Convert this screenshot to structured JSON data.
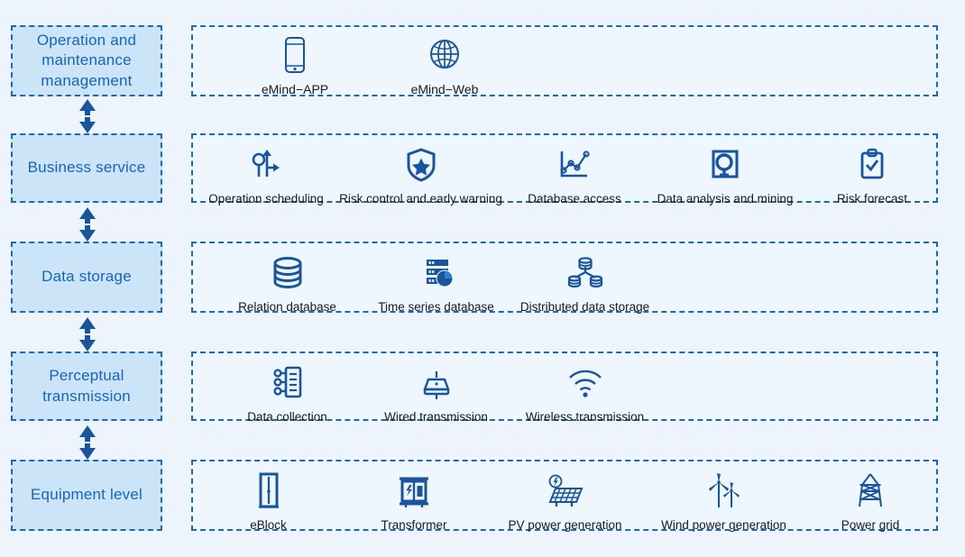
{
  "diagram": {
    "title": "Layered system architecture",
    "colors": {
      "background": "#eef4fc",
      "level_box_fill": "#cce4f7",
      "panel_fill": "#eef6fe",
      "border": "#1a6ab8",
      "level_text": "#1565c0",
      "icon": "#19559e",
      "caption_text": "#1b1b1b"
    },
    "levels": [
      {
        "id": "operation-and-maintenance-management",
        "label": "Operation and maintenance management",
        "items": [
          {
            "label": "eMind−APP",
            "icon": "smartphone-icon"
          },
          {
            "label": "eMind−Web",
            "icon": "globe-icon"
          }
        ]
      },
      {
        "id": "business-service",
        "label": "Business service",
        "items": [
          {
            "label": "Operation scheduling",
            "icon": "routing-arrows-icon"
          },
          {
            "label": "Risk control and early warning",
            "icon": "shield-star-icon"
          },
          {
            "label": "Database access",
            "icon": "line-chart-icon"
          },
          {
            "label": "Data analysis and mining",
            "icon": "magnifier-analysis-icon"
          },
          {
            "label": "Risk forecast",
            "icon": "clipboard-check-icon"
          }
        ]
      },
      {
        "id": "data-storage",
        "label": "Data storage",
        "items": [
          {
            "label": "Relation database",
            "icon": "database-cylinder-icon"
          },
          {
            "label": "Time series database",
            "icon": "server-pie-icon"
          },
          {
            "label": "Distributed data storage",
            "icon": "distributed-database-icon"
          }
        ]
      },
      {
        "id": "perceptual-transmission",
        "label": "Perceptual transmission",
        "items": [
          {
            "label": "Data collection",
            "icon": "data-collection-icon"
          },
          {
            "label": "Wired transmission",
            "icon": "wired-router-icon"
          },
          {
            "label": "Wireless transmission",
            "icon": "wifi-icon"
          }
        ]
      },
      {
        "id": "equipment-level",
        "label": "Equipment level",
        "items": [
          {
            "label": "eBlock",
            "icon": "cabinet-icon"
          },
          {
            "label": "Transformer",
            "icon": "transformer-icon"
          },
          {
            "label": "PV power generation",
            "icon": "solar-panel-icon"
          },
          {
            "label": "Wind power generation",
            "icon": "wind-turbine-icon"
          },
          {
            "label": "Power grid",
            "icon": "pylon-icon"
          }
        ]
      }
    ],
    "connectors": [
      {
        "id": "connector-1",
        "between": "operation-and-maintenance-management / business-service",
        "direction": "bidirectional"
      },
      {
        "id": "connector-2",
        "between": "business-service / data-storage",
        "direction": "bidirectional"
      },
      {
        "id": "connector-3",
        "between": "data-storage / perceptual-transmission",
        "direction": "bidirectional"
      },
      {
        "id": "connector-4",
        "between": "perceptual-transmission / equipment-level",
        "direction": "bidirectional"
      }
    ]
  }
}
